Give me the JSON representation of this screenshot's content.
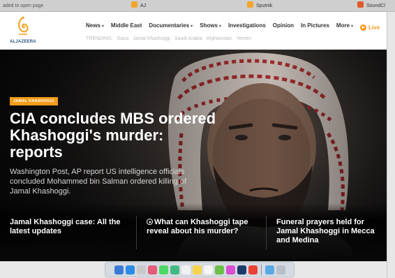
{
  "browser": {
    "tabs": [
      {
        "label": "aded to open page",
        "icon": ""
      },
      {
        "label": "AJ",
        "icon": "aljazeera-favicon"
      },
      {
        "label": "Sputnik",
        "icon": "sputnik-favicon"
      },
      {
        "label": "SoundCl",
        "icon": "soundcloud-favicon"
      }
    ]
  },
  "site": {
    "logo_text": "ALJAZEERA",
    "nav": [
      {
        "label": "News",
        "dropdown": true
      },
      {
        "label": "Middle East",
        "dropdown": false
      },
      {
        "label": "Documentaries",
        "dropdown": true
      },
      {
        "label": "Shows",
        "dropdown": true
      },
      {
        "label": "Investigations",
        "dropdown": false
      },
      {
        "label": "Opinion",
        "dropdown": false
      },
      {
        "label": "In Pictures",
        "dropdown": false
      },
      {
        "label": "More",
        "dropdown": true
      }
    ],
    "live_label": "Live",
    "trending_label": "TRENDING:",
    "trending": [
      "Gaza",
      "Jamal Khashoggi",
      "Saudi Arabia",
      "Afghanistan",
      "Yemen"
    ]
  },
  "hero": {
    "tag": "JAMAL KHASHOGGI",
    "headline": "CIA concludes MBS ordered Khashoggi's murder: reports",
    "summary": "Washington Post, AP report US intelligence officials concluded Mohammed bin Salman ordered killing of Jamal Khashoggi."
  },
  "related": [
    {
      "title": "Jamal Khashoggi case: All the latest updates",
      "video": false
    },
    {
      "title": "What can Khashoggi tape reveal about his murder?",
      "video": true
    },
    {
      "title": "Funeral prayers held for Jamal Khashoggi in Mecca and Medina",
      "video": false
    }
  ],
  "colors": {
    "accent": "#f49c1b",
    "nav_text": "#333333",
    "trending_text": "#b9b9b9",
    "hero_text": "#ffffff"
  },
  "dock": {
    "icons": [
      "finder-icon",
      "safari-icon",
      "launchpad-icon",
      "photos-icon",
      "messages-icon",
      "facetime-icon",
      "calendar-icon",
      "notes-icon",
      "reminders-icon",
      "maps-icon",
      "itunes-icon",
      "photoshop-icon",
      "chrome-icon",
      "folder-icon",
      "trash-icon"
    ],
    "colors": [
      "#3a7bd5",
      "#2b8de8",
      "#c9c9c9",
      "#e65a7a",
      "#4cd964",
      "#42b883",
      "#f0f0f0",
      "#f7d34b",
      "#f5f5f5",
      "#6cc04a",
      "#d94fd1",
      "#1a3b6b",
      "#e94235",
      "#5aa9e6",
      "#b8bfc8"
    ]
  }
}
